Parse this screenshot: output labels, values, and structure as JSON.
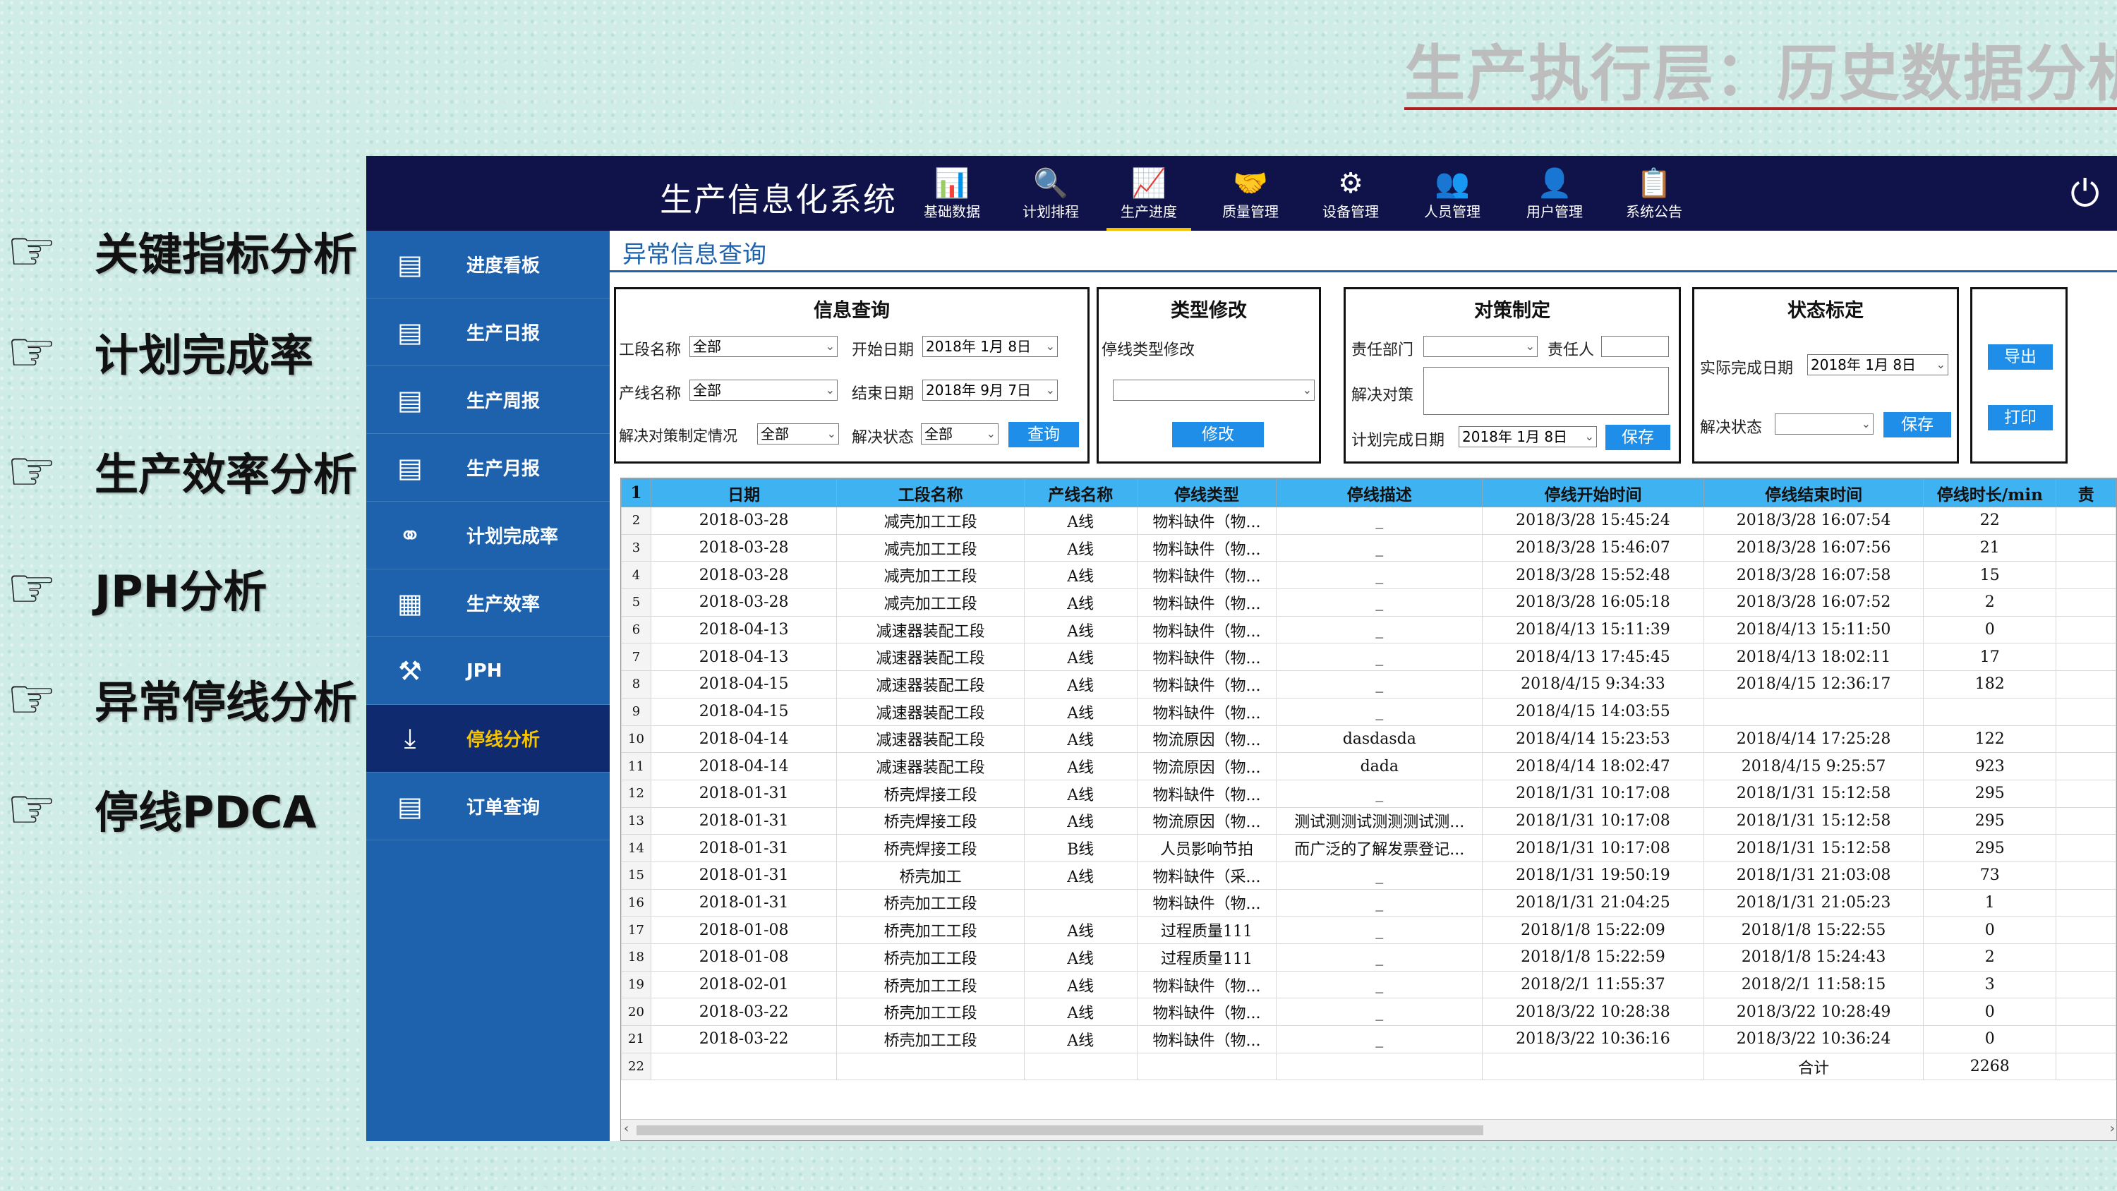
{
  "slide": {
    "title": "生产执行层：历史数据分析"
  },
  "bullets": [
    {
      "icon": "pointing-hand-icon",
      "label": "关键指标分析"
    },
    {
      "icon": "pointing-hand-icon",
      "label": "计划完成率"
    },
    {
      "icon": "pointing-hand-icon",
      "label": "生产效率分析"
    },
    {
      "icon": "pointing-hand-icon",
      "label": "JPH分析"
    },
    {
      "icon": "pointing-hand-icon",
      "label": "异常停线分析"
    },
    {
      "icon": "pointing-hand-icon",
      "label": "停线PDCA"
    }
  ],
  "app": {
    "title": "生产信息化系统",
    "topnav": [
      {
        "icon": "bar-chart-icon",
        "label": "基础数据"
      },
      {
        "icon": "schedule-icon",
        "label": "计划排程"
      },
      {
        "icon": "line-chart-icon",
        "label": "生产进度",
        "active": true
      },
      {
        "icon": "quality-handshake-icon",
        "label": "质量管理"
      },
      {
        "icon": "equipment-icon",
        "label": "设备管理"
      },
      {
        "icon": "people-icon",
        "label": "人员管理"
      },
      {
        "icon": "user-icon",
        "label": "用户管理"
      },
      {
        "icon": "notice-icon",
        "label": "系统公告"
      }
    ],
    "sidebar": [
      {
        "icon": "dashboard-icon",
        "label": "进度看板"
      },
      {
        "icon": "report-icon",
        "label": "生产日报"
      },
      {
        "icon": "report-icon",
        "label": "生产周报"
      },
      {
        "icon": "report-icon",
        "label": "生产月报"
      },
      {
        "icon": "link-icon",
        "label": "计划完成率"
      },
      {
        "icon": "grid-icon",
        "label": "生产效率"
      },
      {
        "icon": "wrench-icon",
        "label": "JPH"
      },
      {
        "icon": "download-icon",
        "label": "停线分析",
        "active": true
      },
      {
        "icon": "document-icon",
        "label": "订单查询"
      }
    ],
    "page_title": "异常信息查询",
    "info_panel": {
      "title": "信息查询",
      "section_label": "工段名称",
      "section_value": "全部",
      "line_label": "产线名称",
      "line_value": "全部",
      "start_label": "开始日期",
      "start_value": "2018年 1月 8日",
      "end_label": "结束日期",
      "end_value": "2018年 9月 7日",
      "policy_label": "解决对策制定情况",
      "policy_value": "全部",
      "status_label": "解决状态",
      "status_value": "全部",
      "query_button": "查询"
    },
    "type_panel": {
      "title": "类型修改",
      "label": "停线类型修改",
      "value": "",
      "button": "修改"
    },
    "measure_panel": {
      "title": "对策制定",
      "dept_label": "责任部门",
      "dept_value": "",
      "owner_label": "责任人",
      "owner_value": "",
      "measure_label": "解决对策",
      "measure_value": "",
      "plan_label": "计划完成日期",
      "plan_value": "2018年 1月 8日",
      "save_button": "保存"
    },
    "status_panel": {
      "title": "状态标定",
      "done_label": "实际完成日期",
      "done_value": "2018年 1月 8日",
      "state_label": "解决状态",
      "state_value": "",
      "save_button": "保存"
    },
    "export_panel": {
      "export_button": "导出",
      "print_button": "打印"
    },
    "table": {
      "columns": [
        "日期",
        "工段名称",
        "产线名称",
        "停线类型",
        "停线描述",
        "停线开始时间",
        "停线结束时间",
        "停线时长/min",
        "责"
      ],
      "rows": [
        [
          "2018-03-28",
          "减壳加工工段",
          "A线",
          "物料缺件（物...",
          "_",
          "2018/3/28 15:45:24",
          "2018/3/28 16:07:54",
          "22",
          ""
        ],
        [
          "2018-03-28",
          "减壳加工工段",
          "A线",
          "物料缺件（物...",
          "_",
          "2018/3/28 15:46:07",
          "2018/3/28 16:07:56",
          "21",
          ""
        ],
        [
          "2018-03-28",
          "减壳加工工段",
          "A线",
          "物料缺件（物...",
          "_",
          "2018/3/28 15:52:48",
          "2018/3/28 16:07:58",
          "15",
          ""
        ],
        [
          "2018-03-28",
          "减壳加工工段",
          "A线",
          "物料缺件（物...",
          "_",
          "2018/3/28 16:05:18",
          "2018/3/28 16:07:52",
          "2",
          ""
        ],
        [
          "2018-04-13",
          "减速器装配工段",
          "A线",
          "物料缺件（物...",
          "_",
          "2018/4/13 15:11:39",
          "2018/4/13 15:11:50",
          "0",
          ""
        ],
        [
          "2018-04-13",
          "减速器装配工段",
          "A线",
          "物料缺件（物...",
          "_",
          "2018/4/13 17:45:45",
          "2018/4/13 18:02:11",
          "17",
          ""
        ],
        [
          "2018-04-15",
          "减速器装配工段",
          "A线",
          "物料缺件（物...",
          "_",
          "2018/4/15 9:34:33",
          "2018/4/15 12:36:17",
          "182",
          ""
        ],
        [
          "2018-04-15",
          "减速器装配工段",
          "A线",
          "物料缺件（物...",
          "_",
          "2018/4/15 14:03:55",
          "",
          "",
          ""
        ],
        [
          "2018-04-14",
          "减速器装配工段",
          "A线",
          "物流原因（物...",
          "dasdasda",
          "2018/4/14 15:23:53",
          "2018/4/14 17:25:28",
          "122",
          ""
        ],
        [
          "2018-04-14",
          "减速器装配工段",
          "A线",
          "物流原因（物...",
          "dada",
          "2018/4/14 18:02:47",
          "2018/4/15 9:25:57",
          "923",
          ""
        ],
        [
          "2018-01-31",
          "桥壳焊接工段",
          "A线",
          "物料缺件（物...",
          "_",
          "2018/1/31 10:17:08",
          "2018/1/31 15:12:58",
          "295",
          ""
        ],
        [
          "2018-01-31",
          "桥壳焊接工段",
          "A线",
          "物流原因（物...",
          "测试测测试测测测试测...",
          "2018/1/31 10:17:08",
          "2018/1/31 15:12:58",
          "295",
          ""
        ],
        [
          "2018-01-31",
          "桥壳焊接工段",
          "B线",
          "人员影响节拍",
          "而广泛的了解发票登记...",
          "2018/1/31 10:17:08",
          "2018/1/31 15:12:58",
          "295",
          ""
        ],
        [
          "2018-01-31",
          "桥壳加工",
          "A线",
          "物料缺件（采...",
          "_",
          "2018/1/31 19:50:19",
          "2018/1/31 21:03:08",
          "73",
          ""
        ],
        [
          "2018-01-31",
          "桥壳加工工段",
          "",
          "物料缺件（物...",
          "_",
          "2018/1/31 21:04:25",
          "2018/1/31 21:05:23",
          "1",
          ""
        ],
        [
          "2018-01-08",
          "桥壳加工工段",
          "A线",
          "过程质量111",
          "_",
          "2018/1/8 15:22:09",
          "2018/1/8 15:22:55",
          "0",
          ""
        ],
        [
          "2018-01-08",
          "桥壳加工工段",
          "A线",
          "过程质量111",
          "_",
          "2018/1/8 15:22:59",
          "2018/1/8 15:24:43",
          "2",
          ""
        ],
        [
          "2018-02-01",
          "桥壳加工工段",
          "A线",
          "物料缺件（物...",
          "_",
          "2018/2/1 11:55:37",
          "2018/2/1 11:58:15",
          "3",
          ""
        ],
        [
          "2018-03-22",
          "桥壳加工工段",
          "A线",
          "物料缺件（物...",
          "_",
          "2018/3/22 10:28:38",
          "2018/3/22 10:28:49",
          "0",
          ""
        ],
        [
          "2018-03-22",
          "桥壳加工工段",
          "A线",
          "物料缺件（物...",
          "_",
          "2018/3/22 10:36:16",
          "2018/3/22 10:36:24",
          "0",
          ""
        ],
        [
          "",
          "",
          "",
          "",
          "",
          "",
          "合计",
          "2268",
          ""
        ]
      ]
    }
  }
}
